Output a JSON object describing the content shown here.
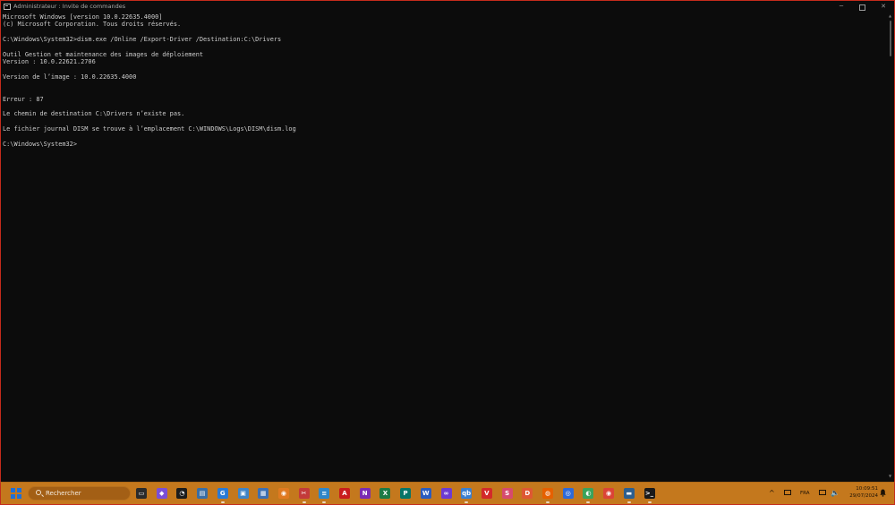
{
  "window": {
    "title": "Administrateur : Invite de commandes",
    "controls": {
      "minimize": "─",
      "close": "✕"
    }
  },
  "console": {
    "lines": [
      "Microsoft Windows [version 10.0.22635.4000]",
      "(c) Microsoft Corporation. Tous droits réservés.",
      "",
      "C:\\Windows\\System32>dism.exe /Online /Export-Driver /Destination:C:\\Drivers",
      "",
      "Outil Gestion et maintenance des images de déploiement",
      "Version : 10.0.22621.2706",
      "",
      "Version de l’image : 10.0.22635.4000",
      "",
      "",
      "Erreur : 87",
      "",
      "Le chemin de destination C:\\Drivers n’existe pas.",
      "",
      "Le fichier journal DISM se trouve à l’emplacement C:\\WINDOWS\\Logs\\DISM\\dism.log",
      "",
      "C:\\Windows\\System32>"
    ]
  },
  "taskbar": {
    "search_label": "Rechercher",
    "apps": [
      {
        "name": "task-view-icon",
        "glyph": "▭",
        "color": "#2b2b2b",
        "running": false
      },
      {
        "name": "widgets-icon",
        "glyph": "◆",
        "color": "#7a4fd6",
        "running": false
      },
      {
        "name": "speedometer-icon",
        "glyph": "◔",
        "color": "#1c1c1c",
        "running": false
      },
      {
        "name": "image-viewer-icon",
        "glyph": "▤",
        "color": "#3a6ea5",
        "running": false
      },
      {
        "name": "edge-like-icon",
        "glyph": "G",
        "color": "#2a7ad5",
        "running": true
      },
      {
        "name": "remote-desktop-icon",
        "glyph": "▣",
        "color": "#3f84c6",
        "running": false
      },
      {
        "name": "control-panel-icon",
        "glyph": "▦",
        "color": "#3d6fb2",
        "running": false
      },
      {
        "name": "paint-icon",
        "glyph": "◉",
        "color": "#e07a20",
        "running": false
      },
      {
        "name": "snipping-tool-icon",
        "glyph": "✂",
        "color": "#c33a3a",
        "running": true
      },
      {
        "name": "notepad-icon",
        "glyph": "≡",
        "color": "#2f86c9",
        "running": true
      },
      {
        "name": "acrobat-icon",
        "glyph": "A",
        "color": "#c91d1d",
        "running": false
      },
      {
        "name": "onenote-icon",
        "glyph": "N",
        "color": "#7b2bb3",
        "running": false
      },
      {
        "name": "excel-icon",
        "glyph": "X",
        "color": "#1d7a45",
        "running": false
      },
      {
        "name": "publisher-icon",
        "glyph": "P",
        "color": "#077568",
        "running": false
      },
      {
        "name": "word-icon",
        "glyph": "W",
        "color": "#2b5cbf",
        "running": false
      },
      {
        "name": "copilot-icon",
        "glyph": "∞",
        "color": "#6d3bd1",
        "running": false
      },
      {
        "name": "qbittorrent-icon",
        "glyph": "qb",
        "color": "#3b7fd0",
        "running": true
      },
      {
        "name": "vivaldi-icon",
        "glyph": "V",
        "color": "#d32a2a",
        "running": false
      },
      {
        "name": "app-s-icon",
        "glyph": "S",
        "color": "#d64a6e",
        "running": false
      },
      {
        "name": "duckduckgo-icon",
        "glyph": "D",
        "color": "#de5833",
        "running": false
      },
      {
        "name": "firefox-icon",
        "glyph": "◍",
        "color": "#e66000",
        "running": true
      },
      {
        "name": "chromium-icon",
        "glyph": "◎",
        "color": "#2f6ad8",
        "running": false
      },
      {
        "name": "thorium-icon",
        "glyph": "◐",
        "color": "#3aa35c",
        "running": true
      },
      {
        "name": "chrome-icon",
        "glyph": "◉",
        "color": "#db4437",
        "running": false
      },
      {
        "name": "desktop-app-icon",
        "glyph": "▬",
        "color": "#2d5f8f",
        "running": true
      },
      {
        "name": "terminal-icon",
        "glyph": ">_",
        "color": "#1a1a1a",
        "running": true
      }
    ]
  },
  "tray": {
    "chevron": "^",
    "language": "FRA",
    "volume_glyph": "🔈",
    "time": "10:09:51",
    "date": "29/07/2024"
  }
}
